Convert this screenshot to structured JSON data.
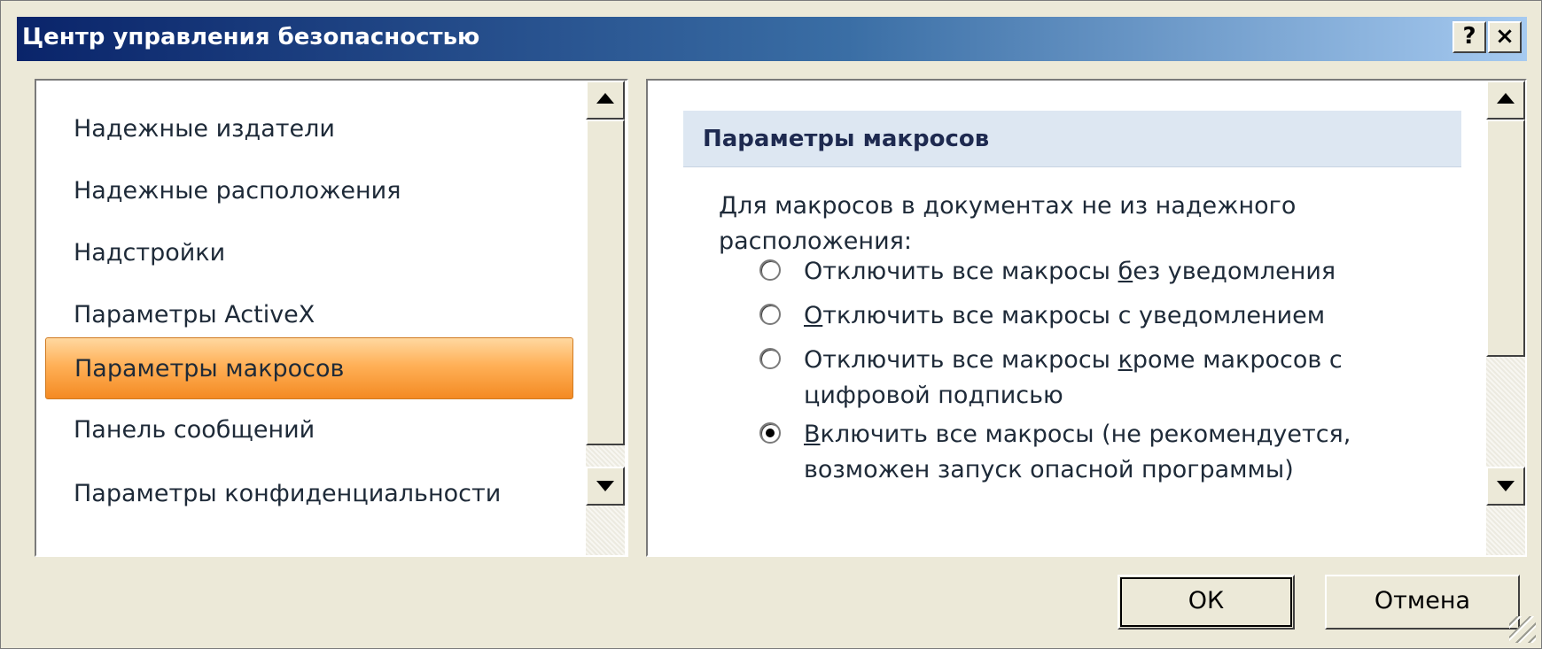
{
  "window": {
    "title": "Центр управления безопасностью",
    "help_label": "?",
    "close_label": "×"
  },
  "sidebar": {
    "items": [
      {
        "label": "Надежные издатели",
        "selected": false
      },
      {
        "label": "Надежные расположения",
        "selected": false
      },
      {
        "label": "Надстройки",
        "selected": false
      },
      {
        "label": "Параметры ActiveX",
        "selected": false
      },
      {
        "label": "Параметры макросов",
        "selected": true
      },
      {
        "label": "Панель сообщений",
        "selected": false
      },
      {
        "label": "Параметры конфиденциальности",
        "selected": false
      }
    ]
  },
  "main": {
    "section_title": "Параметры макросов",
    "description": "Для макросов в документах не из надежного расположения:",
    "options": [
      {
        "before": "Отключить все макросы ",
        "accel": "б",
        "after": "ез уведомления",
        "checked": false
      },
      {
        "before": "",
        "accel": "О",
        "after": "тключить все макросы с уведомлением",
        "checked": false
      },
      {
        "before": "Отключить все макросы ",
        "accel": "к",
        "after": "роме макросов с цифровой подписью",
        "checked": false
      },
      {
        "before": "",
        "accel": "В",
        "after": "ключить все макросы (не рекомендуется, возможен запуск опасной программы)",
        "checked": true
      }
    ]
  },
  "buttons": {
    "ok_label": "ОК",
    "cancel_label": "Отмена"
  },
  "icons": [
    "help-icon",
    "close-icon",
    "scroll-up-icon",
    "scroll-down-icon",
    "radio-icon",
    "resize-grip-icon"
  ],
  "colors": {
    "title_gradient_start": "#0a246a",
    "selection_orange": "#f48a23",
    "section_header_bg": "#dde7f2"
  }
}
